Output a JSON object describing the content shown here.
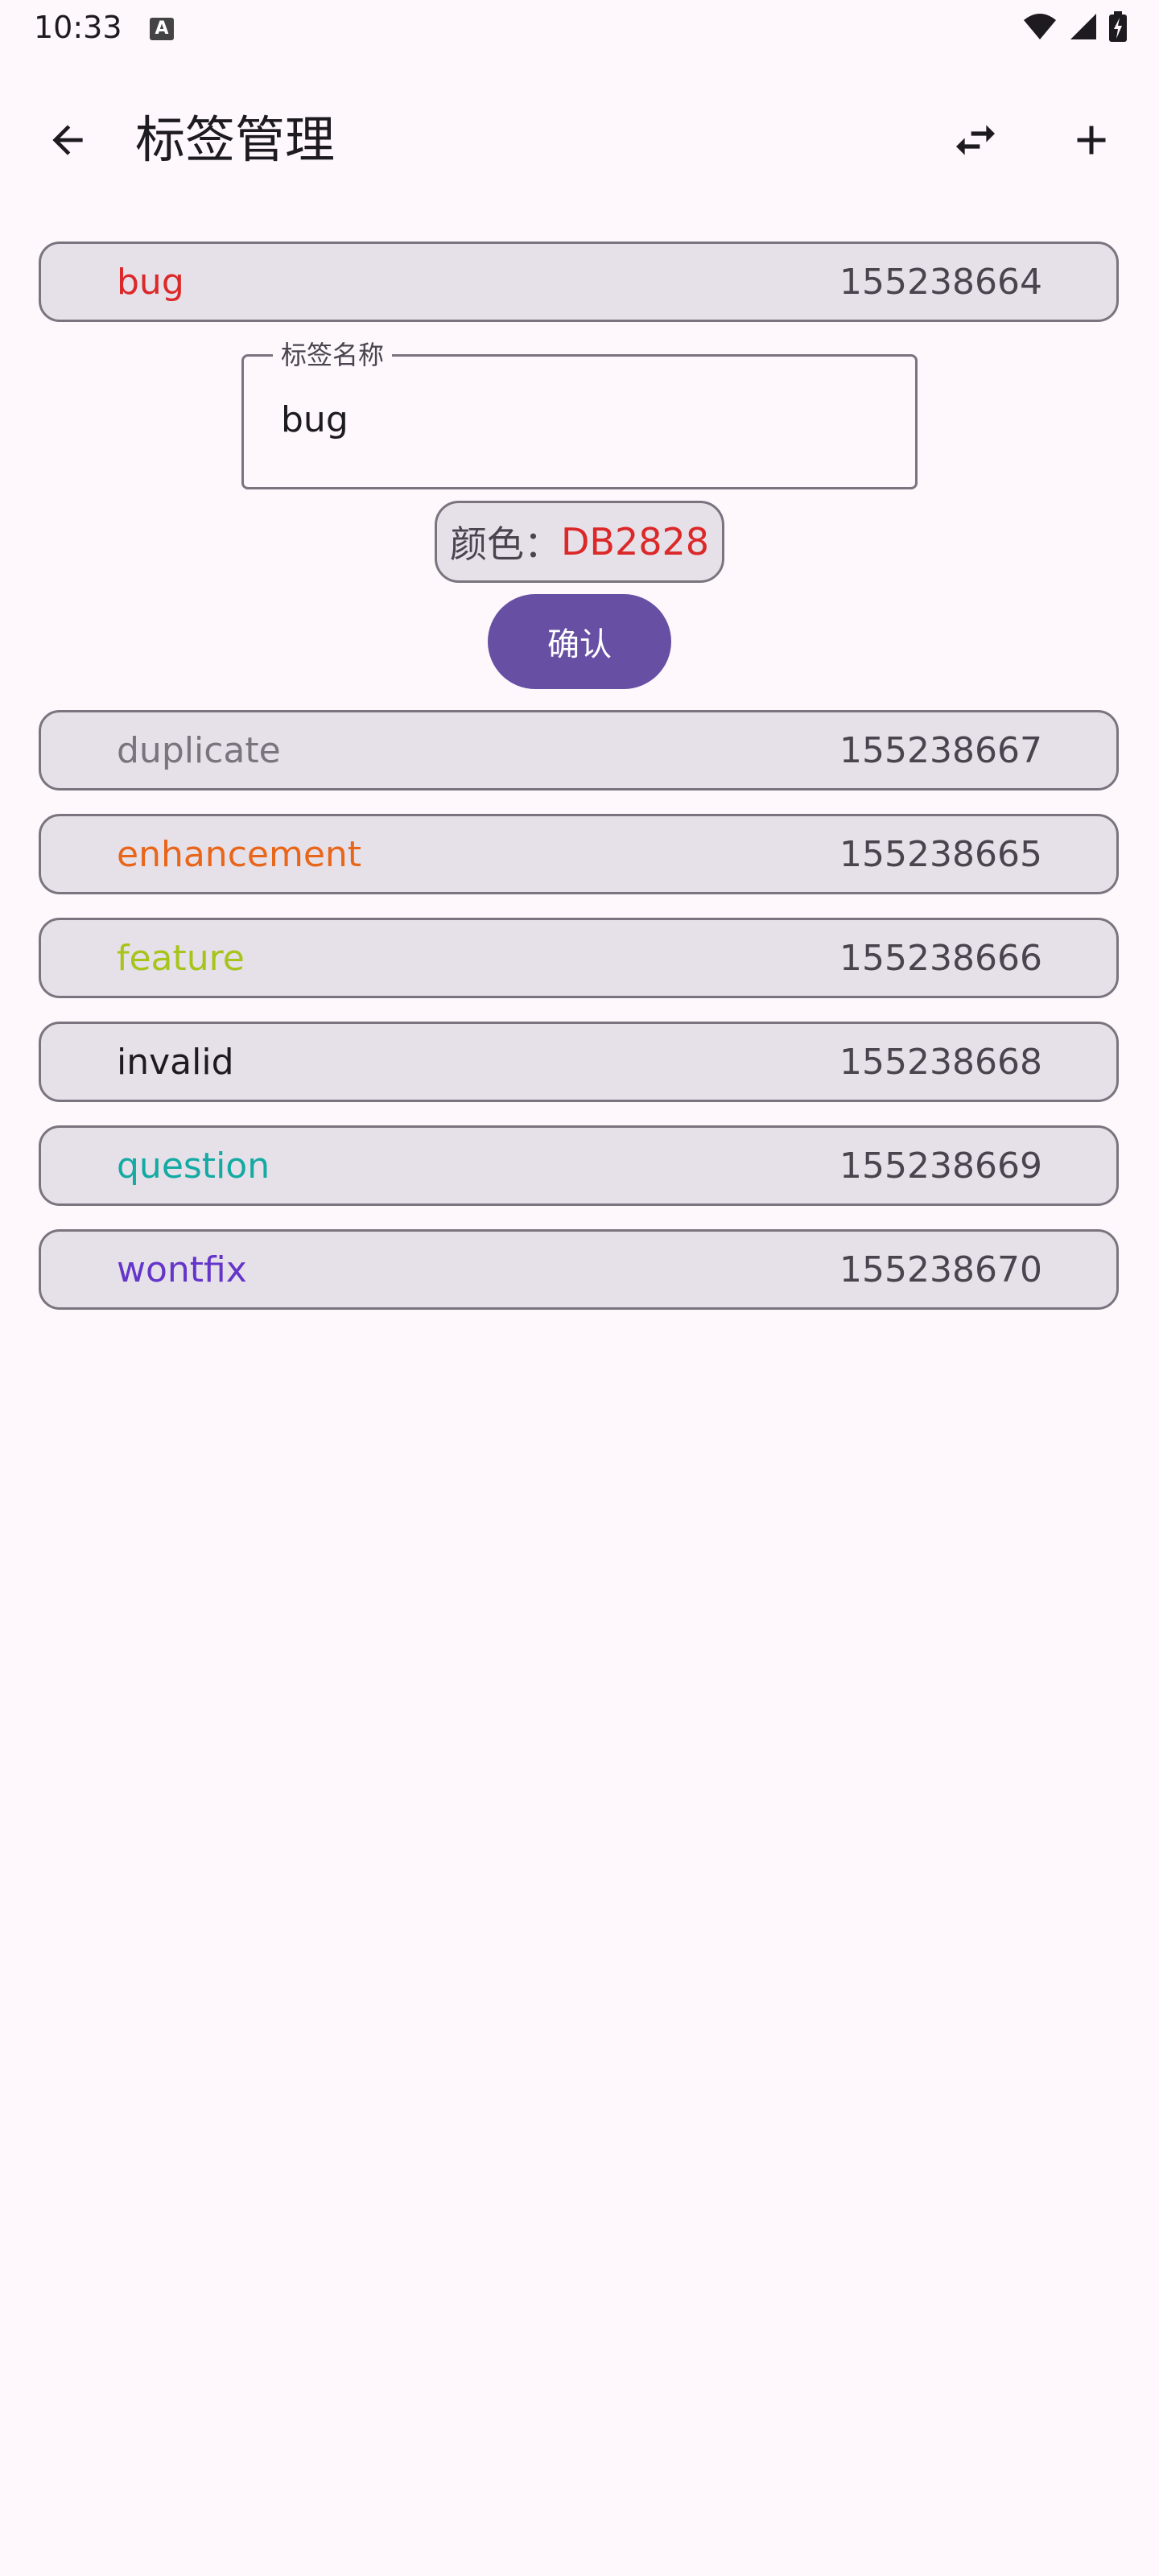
{
  "status_bar": {
    "time": "10:33",
    "notification_icon_letter": "A"
  },
  "app_bar": {
    "title": "标签管理"
  },
  "selected_tag": {
    "name": "bug",
    "id": "155238664",
    "color": "#db2828"
  },
  "editor": {
    "field_label": "标签名称",
    "field_value": "bug",
    "color_label": "颜色：",
    "color_value": "DB2828",
    "confirm_label": "确认"
  },
  "tags": [
    {
      "name": "duplicate",
      "id": "155238667",
      "color": "#79747e"
    },
    {
      "name": "enhancement",
      "id": "155238665",
      "color": "#e8661a"
    },
    {
      "name": "feature",
      "id": "155238666",
      "color": "#a6c41a"
    },
    {
      "name": "invalid",
      "id": "155238668",
      "color": "#1d1b20"
    },
    {
      "name": "question",
      "id": "155238669",
      "color": "#13aaa3"
    },
    {
      "name": "wontfix",
      "id": "155238670",
      "color": "#6435c9"
    }
  ],
  "colors": {
    "background": "#fef7fc",
    "chip_fill": "#e6e0e9",
    "primary": "#6750a4",
    "outline": "#79747e"
  }
}
